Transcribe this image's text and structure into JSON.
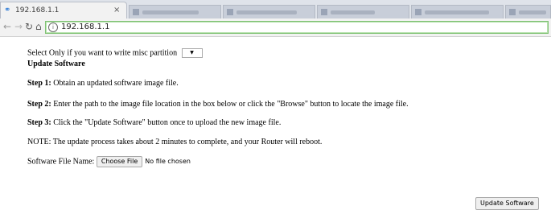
{
  "browser": {
    "active_tab": {
      "favicon": "globe-icon",
      "title": "192.168.1.1",
      "close": "×"
    },
    "address_bar": {
      "info_icon": "info-icon",
      "url": "192.168.1.1"
    }
  },
  "page": {
    "partition_prompt": "Select Only if you want to write misc partition",
    "partition_select_value": "",
    "heading": "Update Software",
    "steps": [
      {
        "label": "Step 1:",
        "text": " Obtain an updated software image file."
      },
      {
        "label": "Step 2:",
        "text": " Enter the path to the image file location in the box below or click the \"Browse\" button to locate the image file."
      },
      {
        "label": "Step 3:",
        "text": " Click the \"Update Software\" button once to upload the new image file."
      }
    ],
    "note": "NOTE: The update process takes about 2 minutes to complete, and your Router will reboot.",
    "file_label": "Software File Name:",
    "choose_file_label": "Choose File",
    "no_file_text": "No file chosen",
    "update_button_label": "Update Software"
  }
}
